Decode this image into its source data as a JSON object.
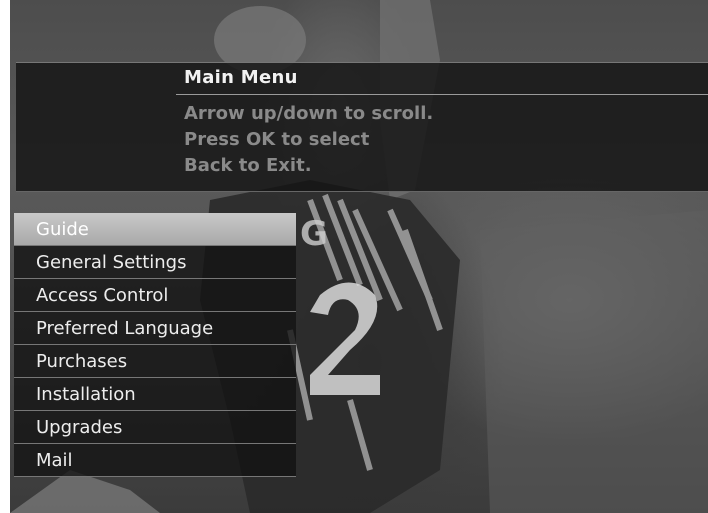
{
  "panel": {
    "title": "Main Menu",
    "instructions": [
      "Arrow up/down to scroll.",
      "Press OK to select",
      "Back to Exit."
    ]
  },
  "menu": {
    "selected_index": 0,
    "items": [
      {
        "label": "Guide"
      },
      {
        "label": "General Settings"
      },
      {
        "label": "Access Control"
      },
      {
        "label": "Preferred Language"
      },
      {
        "label": "Purchases"
      },
      {
        "label": "Installation"
      },
      {
        "label": "Upgrades"
      },
      {
        "label": "Mail"
      }
    ]
  }
}
